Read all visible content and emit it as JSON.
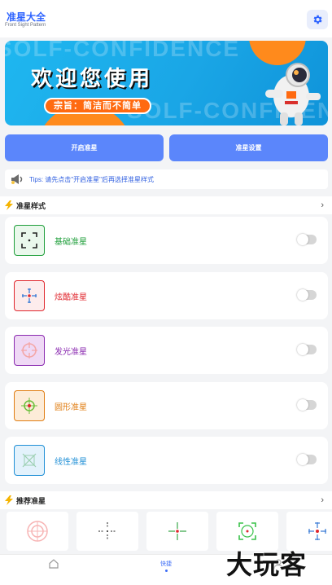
{
  "header": {
    "title": "准星大全",
    "subtitle": "Front Sight Pattern"
  },
  "banner": {
    "title": "欢迎您使用",
    "slogan": "宗旨：简洁而不简单",
    "deco_text": "SOLF-CONFIDENCE"
  },
  "actions": {
    "start_label": "开启准星",
    "settings_label": "准星设置"
  },
  "tips": {
    "text": "Tips: 请先点击\"开启准星\"后再选择准星样式"
  },
  "styles_section": {
    "title": "准星样式",
    "items": [
      {
        "label": "基础准星",
        "color": "#1e9e3a",
        "icon": "basic-crosshair-icon",
        "enabled": false
      },
      {
        "label": "炫酷准星",
        "color": "#e0262d",
        "icon": "cool-crosshair-icon",
        "enabled": false
      },
      {
        "label": "发光准星",
        "color": "#8a2ab0",
        "icon": "glow-crosshair-icon",
        "enabled": false
      },
      {
        "label": "圆形准星",
        "color": "#e07d12",
        "icon": "round-crosshair-icon",
        "enabled": false
      },
      {
        "label": "线性准星",
        "color": "#1f8fd6",
        "icon": "linear-crosshair-icon",
        "enabled": false
      }
    ]
  },
  "recommend_section": {
    "title": "推荐准星"
  },
  "bottom_nav": {
    "items": [
      {
        "label": "",
        "icon": "home-icon",
        "active": false
      },
      {
        "label": "快捷",
        "icon": "",
        "active": true
      },
      {
        "label": "",
        "icon": "user-icon",
        "active": false
      }
    ]
  },
  "watermark": "大玩客",
  "colors": {
    "accent": "#5b86fb",
    "brand": "#2d63ff"
  }
}
